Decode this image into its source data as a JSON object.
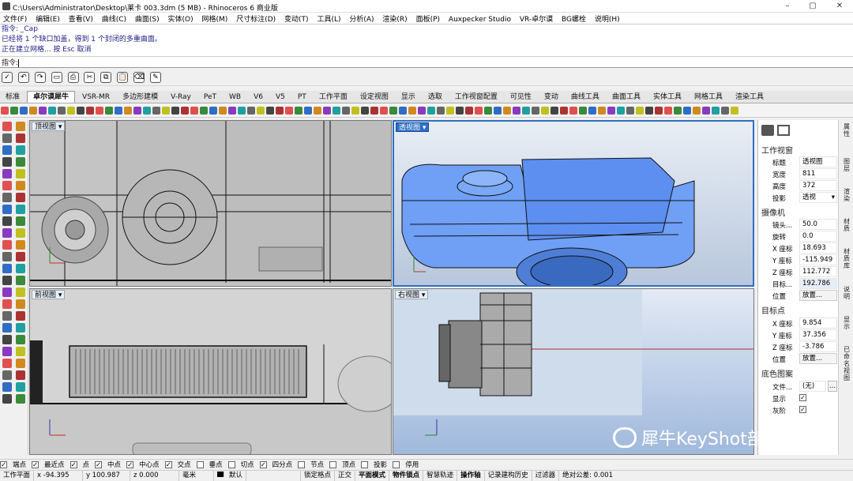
{
  "window": {
    "title": "C:\\Users\\Administrator\\Desktop\\莱卡 003.3dm (5 MB) - Rhinoceros 6 商业版",
    "minimize": "–",
    "maximize": "▢",
    "close": "✕"
  },
  "menu": [
    "文件(F)",
    "编辑(E)",
    "查看(V)",
    "曲线(C)",
    "曲面(S)",
    "实体(O)",
    "网格(M)",
    "尺寸标注(D)",
    "变动(T)",
    "工具(L)",
    "分析(A)",
    "渲染(R)",
    "面板(P)",
    "Auxpecker Studio",
    "VR-卓尔谟",
    "BG螺栓",
    "说明(H)"
  ],
  "command_history": [
    "指令: _Cap",
    "已经将 1 个缺口加盖，得到 1 个封闭的多重曲面。",
    "正在建立网格... 按 Esc 取消"
  ],
  "command_prompt": "指令:",
  "tabs": [
    "标准",
    "卓尔谟犀牛",
    "VSR-MR",
    "多边形建模",
    "V-Ray",
    "PeT",
    "WB",
    "V6",
    "V5",
    "PT",
    "工作平面",
    "设定视图",
    "显示",
    "选取",
    "工作视窗配置",
    "可见性",
    "变动",
    "曲线工具",
    "曲面工具",
    "实体工具",
    "网格工具",
    "渲染工具"
  ],
  "active_tab_index": 1,
  "viewports": {
    "top": "顶视图",
    "perspective": "透视图",
    "front": "前视图",
    "right": "右视图",
    "dropdown": "▾"
  },
  "panel": {
    "section_viewport": "工作视窗",
    "title_label": "标题",
    "title_value": "透视图",
    "width_label": "宽度",
    "width_value": "811",
    "height_label": "高度",
    "height_value": "372",
    "projection_label": "投影",
    "projection_value": "透视",
    "section_camera": "摄像机",
    "lens_label": "镜头...",
    "lens_value": "50.0",
    "rotation_label": "旋转",
    "rotation_value": "0.0",
    "cam_x_label": "X 座标",
    "cam_x_value": "18.693",
    "cam_y_label": "Y 座标",
    "cam_y_value": "-115.949",
    "cam_z_label": "Z 座标",
    "cam_z_value": "112.772",
    "target_dist_label": "目标...",
    "target_dist_value": "192.786",
    "position_label": "位置",
    "position_button": "放置...",
    "section_target": "目标点",
    "tgt_x_label": "X 座标",
    "tgt_x_value": "9.854",
    "tgt_y_label": "Y 座标",
    "tgt_y_value": "37.356",
    "tgt_z_label": "Z 座标",
    "tgt_z_value": "-3.786",
    "tgt_position_label": "位置",
    "tgt_position_button": "放置...",
    "section_wallpaper": "底色图案",
    "file_label": "文件...",
    "file_value": "(无)",
    "file_button": "...",
    "show_label": "显示",
    "gray_label": "灰阶"
  },
  "right_strip": [
    "属性",
    "图层",
    "渲染",
    "材质",
    "材质库",
    "说明",
    "显示",
    "已命名视图"
  ],
  "osnaps": [
    "端点",
    "最近点",
    "点",
    "中点",
    "中心点",
    "交点",
    "垂点",
    "切点",
    "四分点",
    "节点",
    "顶点",
    "投影",
    "停用"
  ],
  "osnaps_checked": [
    true,
    true,
    true,
    true,
    true,
    true,
    false,
    false,
    true,
    false,
    false,
    false,
    false
  ],
  "status": {
    "cplane": "工作平面",
    "x": "x -94.395",
    "y": "y 100.987",
    "z": "z 0.000",
    "units": "毫米",
    "layer": "默认",
    "grid_snap": "锁定格点",
    "ortho": "正交",
    "planar": "平面模式",
    "object_snap": "物件锁点",
    "smart_track": "智慧轨迹",
    "gumball": "操作轴",
    "history": "记录建构历史",
    "filter": "过滤器",
    "tolerance": "绝对公差: 0.001"
  },
  "watermark": "犀牛KeyShot部落",
  "colors": {
    "accent": "#2f6ec4",
    "model_blue": "#6fa0f5",
    "viewport_bg": "#c8d4e4"
  }
}
